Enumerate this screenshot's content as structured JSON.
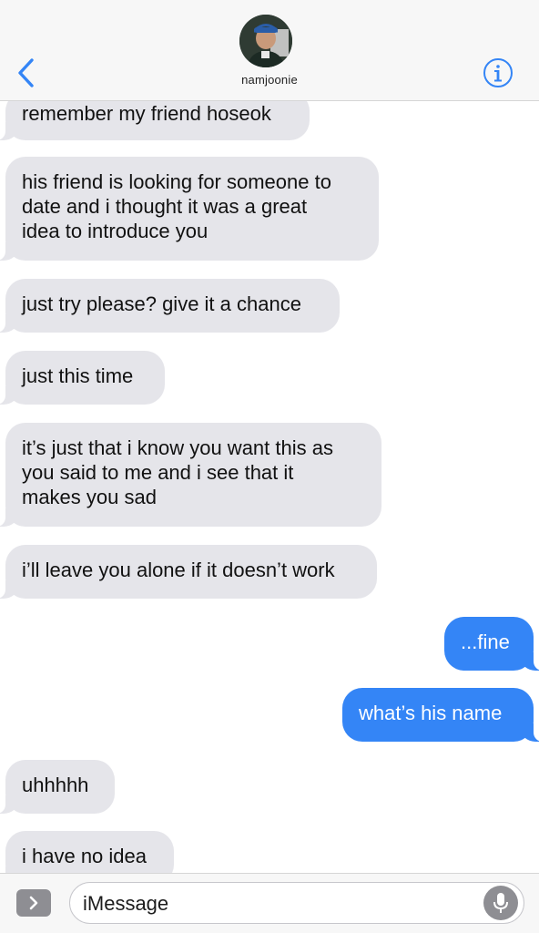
{
  "header": {
    "contact_name": "namjoonie",
    "icons": {
      "back": "chevron-left-icon",
      "info": "info-icon",
      "avatar": "contact-avatar"
    },
    "accent_color": "#3485f6"
  },
  "messages": [
    {
      "direction": "incoming",
      "text": "remember my friend hoseok"
    },
    {
      "direction": "incoming",
      "lines": [
        "his friend is looking for someone to",
        "date and i thought it was a great",
        "idea to introduce you"
      ]
    },
    {
      "direction": "incoming",
      "text": "just try please? give it a chance"
    },
    {
      "direction": "incoming",
      "text": "just this time"
    },
    {
      "direction": "incoming",
      "lines": [
        "it’s just that i know you want this as",
        "you said to me and i see that it",
        "makes you sad"
      ]
    },
    {
      "direction": "incoming",
      "text": "i’ll leave you alone if it doesn’t work"
    },
    {
      "direction": "outgoing",
      "text": "...fine"
    },
    {
      "direction": "outgoing",
      "text": "what’s his name"
    },
    {
      "direction": "incoming",
      "text": "uhhhhh"
    },
    {
      "direction": "incoming",
      "text": "i have no idea"
    }
  ],
  "colors": {
    "incoming_bubble": "#e5e5ea",
    "outgoing_bubble": "#3485f6"
  },
  "input_bar": {
    "placeholder": "iMessage",
    "value": "",
    "icons": {
      "expand": "chevron-right-icon",
      "mic": "microphone-icon"
    }
  }
}
